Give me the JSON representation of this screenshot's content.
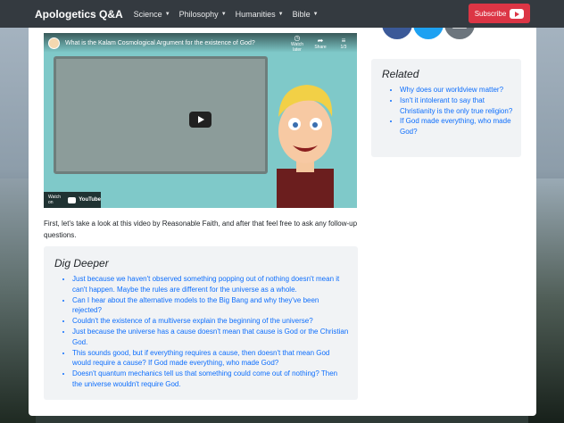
{
  "navbar": {
    "brand": "Apologetics Q&A",
    "items": [
      {
        "label": "Science"
      },
      {
        "label": "Philosophy"
      },
      {
        "label": "Humanities"
      },
      {
        "label": "Bible"
      }
    ],
    "subscribe_label": "Subscribe"
  },
  "video": {
    "title": "What is the Kalam Cosmological Argument for the existence of God?",
    "controls": [
      {
        "label": "Watch later",
        "icon": "clock-icon"
      },
      {
        "label": "Share",
        "icon": "share-icon"
      },
      {
        "label": "1/3",
        "icon": "playlist-icon"
      }
    ],
    "watch_on": "Watch on",
    "watch_on_brand": "YouTube"
  },
  "intro": "First, let's take a look at this video by Reasonable Faith, and after that feel free to ask any follow-up questions.",
  "dig_deeper": {
    "title": "Dig Deeper",
    "items": [
      "Just because we haven't observed something popping out of nothing doesn't mean it can't happen. Maybe the rules are different for the universe as a whole.",
      "Can I hear about the alternative models to the Big Bang and why they've been rejected?",
      "Couldn't the existence of a multiverse explain the beginning of the universe?",
      "Just because the universe has a cause doesn't mean that cause is God or the Christian God.",
      "This sounds good, but if everything requires a cause, then doesn't that mean God would require a cause? If God made everything, who made God?",
      "Doesn't quantum mechanics tell us that something could come out of nothing? Then the universe wouldn't require God."
    ]
  },
  "related": {
    "title": "Related",
    "items": [
      "Why does our worldview matter?",
      "Isn't it intolerant to say that Christianity is the only true religion?",
      "If God made everything, who made God?"
    ]
  },
  "social": [
    {
      "icon": "facebook-icon",
      "color": "#3b5998"
    },
    {
      "icon": "twitter-icon",
      "color": "#1da1f2"
    },
    {
      "icon": "email-icon",
      "color": "#6c757d"
    }
  ],
  "colors": {
    "navbar": "#343a40",
    "subscribe": "#dc3545",
    "link": "#0d6efd",
    "panel": "#f1f3f5"
  }
}
